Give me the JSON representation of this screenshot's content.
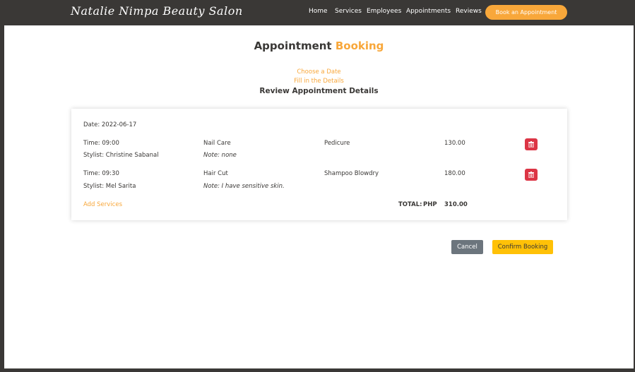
{
  "navbar": {
    "brand": "Natalie Nimpa Beauty Salon",
    "links": [
      "Home",
      "Services",
      "Employees",
      "Appointments",
      "Reviews"
    ],
    "cta_label": "Book an Appointment"
  },
  "page": {
    "title_main": "Appointment",
    "title_accent": "Booking",
    "steps": {
      "choose_date": "Choose a Date",
      "fill_details": "Fill in the Details",
      "current": "Review Appointment Details"
    }
  },
  "summary": {
    "date_label": "Date: 2022-06-17",
    "items": [
      {
        "time": "Time: 09:00",
        "stylist": "Stylist: Christine Sabanal",
        "category": "Nail Care",
        "note": "Note: none",
        "service": "Pedicure",
        "price": "130.00"
      },
      {
        "time": "Time: 09:30",
        "stylist": "Stylist: Mel Sarita",
        "category": "Hair Cut",
        "note": "Note: I have sensitive skin.",
        "service": "Shampoo Blowdry",
        "price": "180.00"
      }
    ],
    "add_services": "Add Services",
    "total_label": "TOTAL:",
    "currency": "PHP",
    "total_value": "310.00"
  },
  "actions": {
    "cancel": "Cancel",
    "confirm": "Confirm Booking"
  },
  "colors": {
    "accent": "#f8a73a",
    "dark": "#3a3836",
    "danger": "#dc3545",
    "warning": "#ffc107",
    "secondary": "#6c757d"
  },
  "icons": {
    "delete": "trash-icon"
  }
}
